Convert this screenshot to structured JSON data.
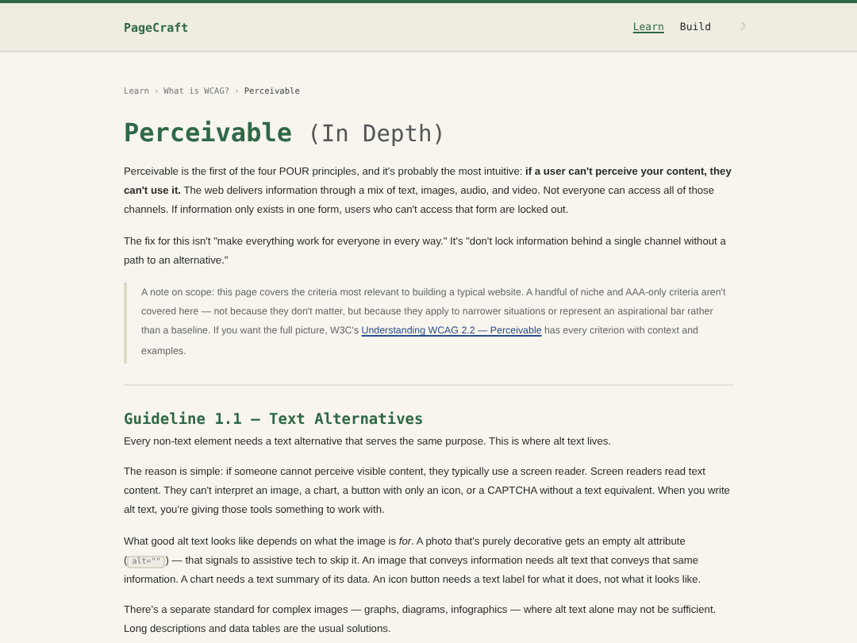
{
  "header": {
    "logo": "PageCraft",
    "nav": [
      {
        "label": "Learn",
        "selected": true
      },
      {
        "label": "Build",
        "selected": false
      }
    ],
    "theme_toggle": "☽"
  },
  "breadcrumb": [
    {
      "label": "Learn"
    },
    {
      "label": "What is WCAG?"
    },
    {
      "label": "Perceivable"
    }
  ],
  "breadcrumb_separator": "›",
  "title": {
    "main": "Perceivable",
    "suffix": "(In Depth)"
  },
  "intro": [
    [
      {
        "kind": "text",
        "text": "Perceivable is the first of the four POUR principles, and it's probably the most intuitive: **if a user can't perceive your content, they can't use it.** The web delivers information through a mix of text, images, audio, and video. Not everyone can access all of those channels. If information only exists in one form, users who can't access that form are locked out."
      }
    ],
    [
      {
        "kind": "text",
        "text": "The fix for this isn't \"make everything work for everyone in every way.\" It's \"don't lock information behind a single channel without a path to an alternative.\""
      }
    ]
  ],
  "note": [
    {
      "kind": "text",
      "text": "A note on scope: this page covers the criteria most relevant to building a typical website. A handful of niche and AAA-only criteria aren't covered here — not because they don't matter, but because they apply to narrower situations or represent an aspirational bar rather than a baseline. If you want the full picture, W3C's "
    },
    {
      "kind": "link",
      "text": "Understanding WCAG 2.2 — Perceivable"
    },
    {
      "kind": "text",
      "text": " has every criterion with context and examples."
    }
  ],
  "section": {
    "heading": "Guideline 1.1 — Text Alternatives",
    "paragraphs": [
      [
        {
          "kind": "text",
          "text": "Every non-text element needs a text alternative that serves the same purpose. This is where alt text lives."
        }
      ],
      [
        {
          "kind": "text",
          "text": "The reason is simple: if someone cannot perceive visible content, they typically use a screen reader. Screen readers read text content. They can't interpret an image, a chart, a button with only an icon, or a CAPTCHA without a text equivalent. When you write alt text, you're giving those tools something to work with."
        }
      ],
      [
        {
          "kind": "text",
          "text": "What good alt text looks like depends on what the image is *for*. A photo that's purely decorative gets an empty alt attribute ("
        },
        {
          "kind": "code",
          "text": "alt=\"\""
        },
        {
          "kind": "text",
          "text": ") — that signals to assistive tech to skip it. An image that conveys information needs alt text that conveys that same information. A chart needs a text summary of its data. An icon button needs a text label for what it does, not what it looks like."
        }
      ],
      [
        {
          "kind": "text",
          "text": "There's a separate standard for complex images — graphs, diagrams, infographics — where alt text alone may not be sufficient. Long descriptions and data tables are the usual solutions."
        }
      ]
    ]
  }
}
